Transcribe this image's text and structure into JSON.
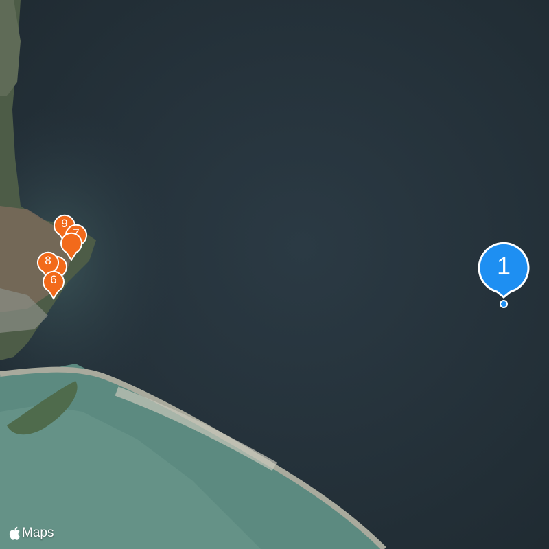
{
  "map": {
    "attribution": "Maps",
    "attribution_icon": "apple-logo-icon",
    "pins": [
      {
        "id": "pin-9",
        "label": "9",
        "color": "#f26a1b",
        "type": "orange"
      },
      {
        "id": "pin-7",
        "label": "7",
        "color": "#f26a1b",
        "type": "orange"
      },
      {
        "id": "pin-5",
        "label": "",
        "color": "#f26a1b",
        "type": "orange"
      },
      {
        "id": "pin-8",
        "label": "8",
        "color": "#f26a1b",
        "type": "orange"
      },
      {
        "id": "pin-4",
        "label": "",
        "color": "#f26a1b",
        "type": "orange"
      },
      {
        "id": "pin-6",
        "label": "6",
        "color": "#f26a1b",
        "type": "orange"
      },
      {
        "id": "pin-1",
        "label": "1",
        "color": "#1e8ff2",
        "type": "blue"
      }
    ]
  }
}
